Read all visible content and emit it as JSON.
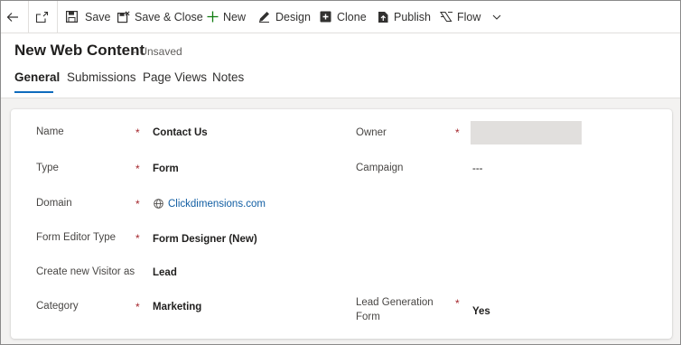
{
  "toolbar": {
    "save": "Save",
    "save_close": "Save & Close",
    "new": "New",
    "design": "Design",
    "clone": "Clone",
    "publish": "Publish",
    "flow": "Flow"
  },
  "header": {
    "title": "New Web Content",
    "status": "- Unsaved"
  },
  "tabs": [
    {
      "label": "General"
    },
    {
      "label": "Submissions"
    },
    {
      "label": "Page Views"
    },
    {
      "label": "Notes"
    }
  ],
  "form": {
    "name": {
      "label": "Name",
      "required": "*",
      "value": "Contact Us"
    },
    "type": {
      "label": "Type",
      "required": "*",
      "value": "Form"
    },
    "domain": {
      "label": "Domain",
      "required": "*",
      "value": "Clickdimensions.com"
    },
    "form_editor_type": {
      "label": "Form Editor Type",
      "required": "*",
      "value": "Form Designer (New)"
    },
    "create_visitor": {
      "label": "Create new Visitor as",
      "value": "Lead"
    },
    "category": {
      "label": "Category",
      "required": "*",
      "value": "Marketing"
    },
    "owner": {
      "label": "Owner",
      "required": "*"
    },
    "campaign": {
      "label": "Campaign",
      "value": "---"
    },
    "lead_generation_form": {
      "label_line1": "Lead Generation",
      "label_line2": "Form",
      "required": "*",
      "value": "Yes"
    }
  },
  "colors": {
    "accent": "#0f6cbd",
    "required": "#a4262c",
    "link": "#115ea3"
  },
  "icons": [
    "back-arrow-icon",
    "popout-icon",
    "save-icon",
    "save-close-icon",
    "plus-icon",
    "design-icon",
    "clone-icon",
    "publish-icon",
    "flow-icon",
    "chevron-down-icon",
    "globe-icon"
  ]
}
